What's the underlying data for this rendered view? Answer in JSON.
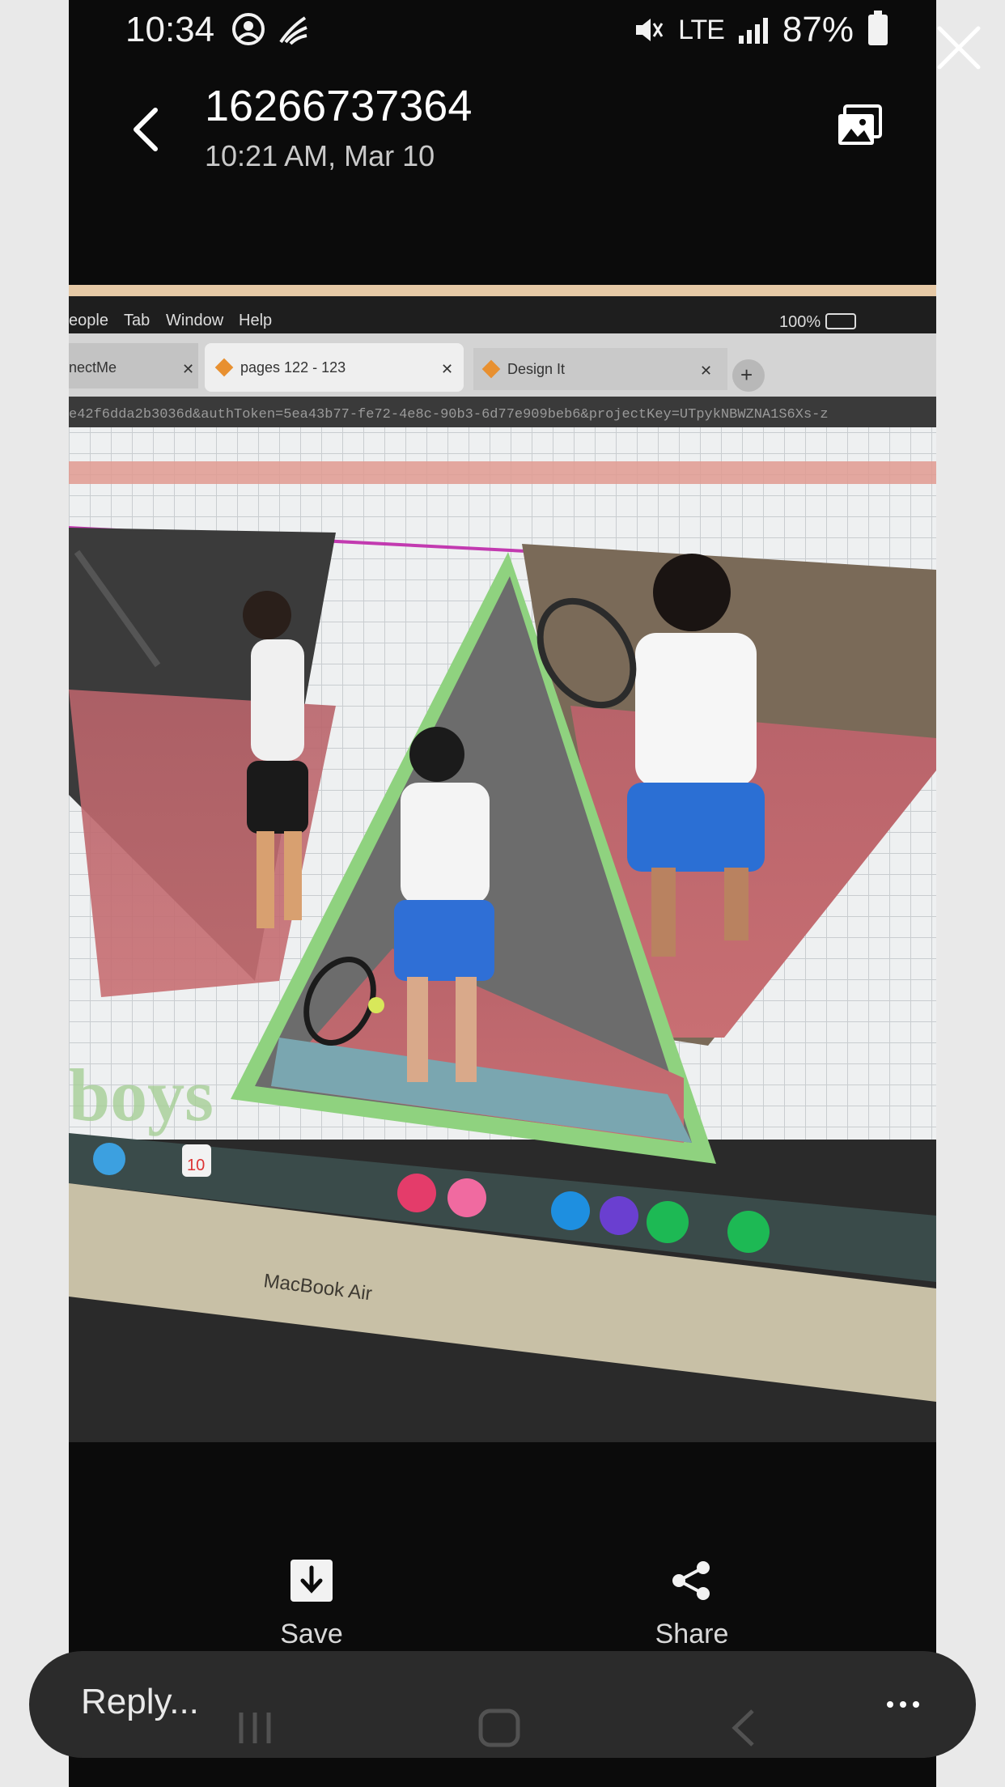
{
  "status_bar": {
    "time": "10:34",
    "network": "LTE",
    "battery": "87%"
  },
  "header": {
    "title": "16266737364",
    "subtitle": "10:21 AM, Mar 10"
  },
  "photo": {
    "menu_items": [
      "eople",
      "Tab",
      "Window",
      "Help"
    ],
    "status_battery": "100%",
    "tabs": [
      "nectMe",
      "pages 122 - 123",
      "Design It"
    ],
    "url_text": "e42f6dda2b3036d&authToken=5ea43b77-fe72-4e8c-90b3-6d77e909beb6&projectKey=UTpykNBWZNA1S6Xs-z",
    "caption_text": "boys",
    "laptop_label": "MacBook Air",
    "calendar_day": "10"
  },
  "actions": {
    "save_label": "Save",
    "share_label": "Share"
  },
  "reply": {
    "placeholder": "Reply..."
  },
  "icons": {
    "back": "back-arrow-icon",
    "gallery": "gallery-icon",
    "close": "close-icon",
    "save": "download-icon",
    "share": "share-icon",
    "more": "more-icon"
  }
}
